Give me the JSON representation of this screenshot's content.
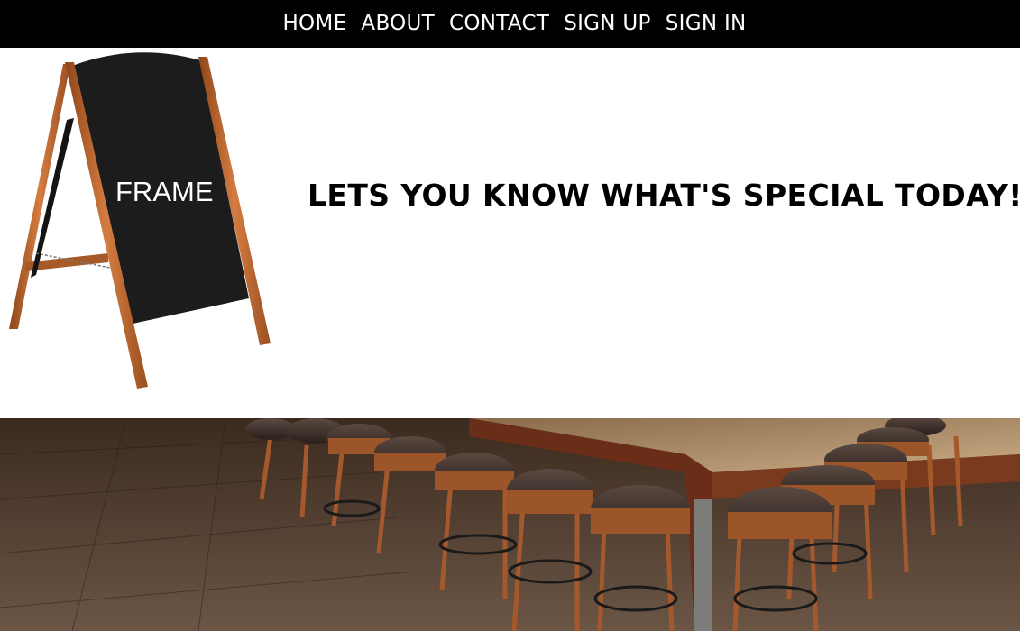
{
  "nav": {
    "items": [
      {
        "label": "HOME"
      },
      {
        "label": "ABOUT"
      },
      {
        "label": "CONTACT"
      },
      {
        "label": "SIGN UP"
      },
      {
        "label": "SIGN IN"
      }
    ]
  },
  "hero": {
    "board_text": "FRAME",
    "tagline": "LETS YOU KNOW WHAT'S SPECIAL TODAY!"
  },
  "colors": {
    "nav_background": "#000000",
    "nav_text": "#ffffff",
    "board": "#1e1e1e",
    "wood_frame": "#c36a35"
  }
}
